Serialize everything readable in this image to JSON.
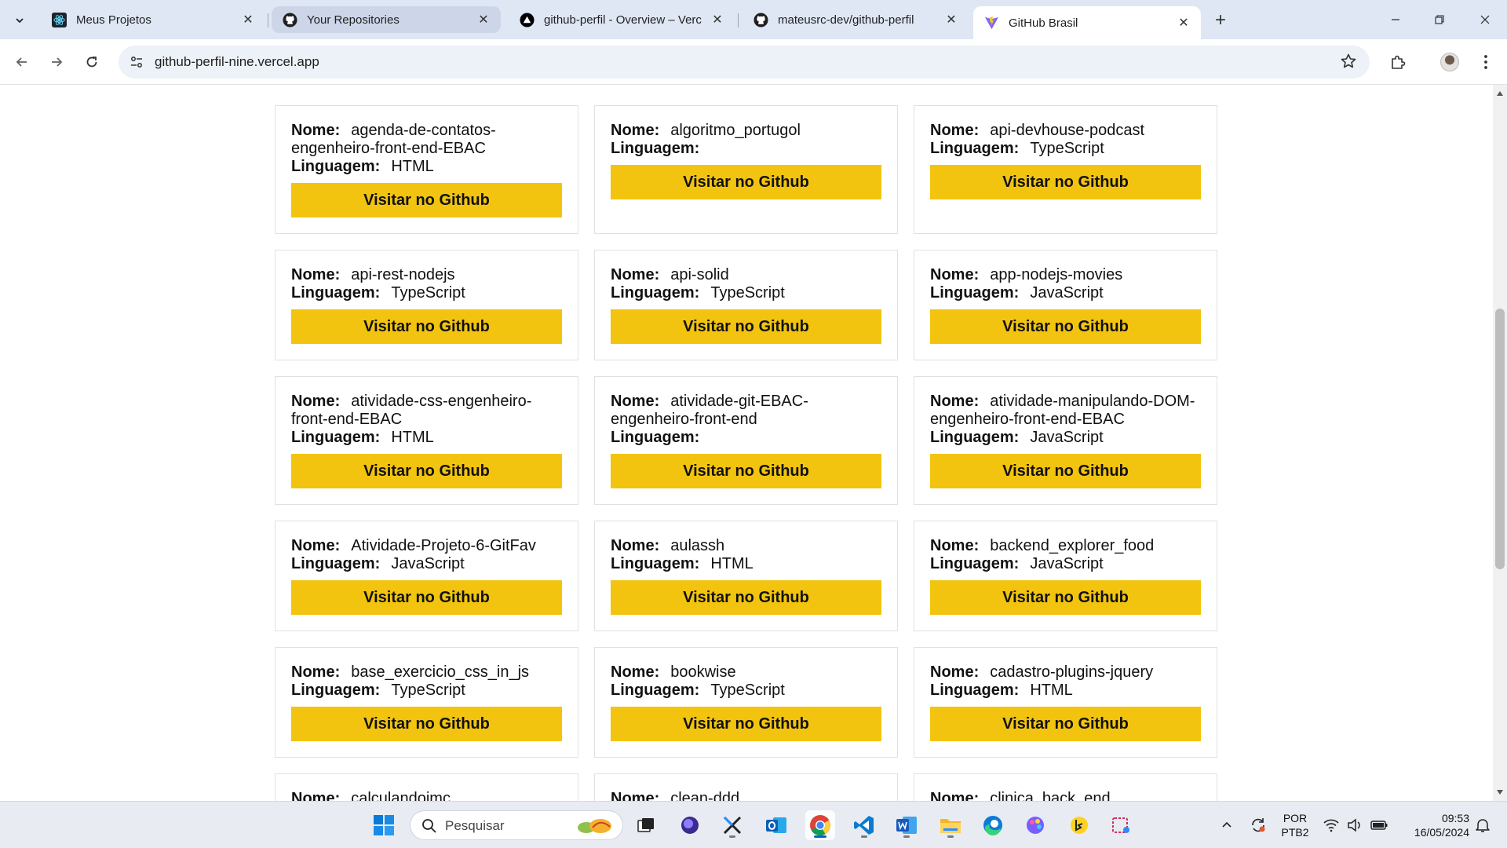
{
  "browser": {
    "tabs": [
      {
        "title": "Meus Projetos",
        "favicon": "react-icon"
      },
      {
        "title": "Your Repositories",
        "favicon": "github-icon"
      },
      {
        "title": "github-perfil - Overview – Verc",
        "favicon": "vercel-icon"
      },
      {
        "title": "mateusrc-dev/github-perfil",
        "favicon": "github-icon"
      },
      {
        "title": "GitHub Brasil",
        "favicon": "vite-icon"
      }
    ],
    "url": "github-perfil-nine.vercel.app"
  },
  "labels": {
    "nome": "Nome:",
    "linguagem": "Linguagem:",
    "visit": "Visitar no Github"
  },
  "repos": [
    {
      "name": "agenda-de-contatos-engenheiro-front-end-EBAC",
      "language": "HTML"
    },
    {
      "name": "algoritmo_portugol",
      "language": ""
    },
    {
      "name": "api-devhouse-podcast",
      "language": "TypeScript"
    },
    {
      "name": "api-rest-nodejs",
      "language": "TypeScript"
    },
    {
      "name": "api-solid",
      "language": "TypeScript"
    },
    {
      "name": "app-nodejs-movies",
      "language": "JavaScript"
    },
    {
      "name": "atividade-css-engenheiro-front-end-EBAC",
      "language": "HTML"
    },
    {
      "name": "atividade-git-EBAC-engenheiro-front-end",
      "language": ""
    },
    {
      "name": "atividade-manipulando-DOM-engenheiro-front-end-EBAC",
      "language": "JavaScript"
    },
    {
      "name": "Atividade-Projeto-6-GitFav",
      "language": "JavaScript"
    },
    {
      "name": "aulassh",
      "language": "HTML"
    },
    {
      "name": "backend_explorer_food",
      "language": "JavaScript"
    },
    {
      "name": "base_exercicio_css_in_js",
      "language": "TypeScript"
    },
    {
      "name": "bookwise",
      "language": "TypeScript"
    },
    {
      "name": "cadastro-plugins-jquery",
      "language": "HTML"
    },
    {
      "name": "calculandoimc",
      "language": ""
    },
    {
      "name": "clean-ddd",
      "language": ""
    },
    {
      "name": "clinica_back_end",
      "language": ""
    }
  ],
  "taskbar": {
    "search_placeholder": "Pesquisar",
    "lang_1": "POR",
    "lang_2": "PTB2",
    "time": "09:53",
    "date": "16/05/2024"
  },
  "colors": {
    "button": "#f2c40f",
    "tabstrip": "#dfe7f5"
  }
}
